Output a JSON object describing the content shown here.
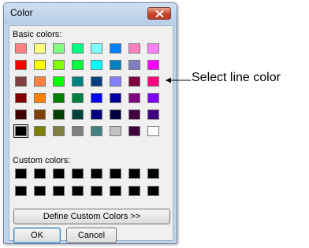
{
  "window": {
    "title": "Color",
    "close_icon": "close-icon"
  },
  "labels": {
    "basic_colors": "Basic colors:",
    "custom_colors": "Custom colors:"
  },
  "basic_colors": [
    [
      "#ff8080",
      "#ffff80",
      "#80ff80",
      "#00ff80",
      "#80ffff",
      "#0080ff",
      "#ff80c0",
      "#ff80ff"
    ],
    [
      "#ff0000",
      "#ffff00",
      "#80ff00",
      "#00ff40",
      "#00ffff",
      "#0080c0",
      "#8080c0",
      "#ff00ff"
    ],
    [
      "#804040",
      "#ff8040",
      "#00ff00",
      "#008080",
      "#004080",
      "#8080ff",
      "#800040",
      "#ff0080"
    ],
    [
      "#800000",
      "#ff8000",
      "#008000",
      "#008040",
      "#0000ff",
      "#0000a0",
      "#800080",
      "#8000ff"
    ],
    [
      "#400000",
      "#804000",
      "#004000",
      "#004040",
      "#000080",
      "#000040",
      "#400040",
      "#400080"
    ],
    [
      "#000000",
      "#808000",
      "#808040",
      "#808080",
      "#408080",
      "#c0c0c0",
      "#400040",
      "#ffffff"
    ]
  ],
  "selected_basic_color": "#000000",
  "custom_colors": [
    [
      "#000000",
      "#000000",
      "#000000",
      "#000000",
      "#000000",
      "#000000",
      "#000000",
      "#000000"
    ],
    [
      "#000000",
      "#000000",
      "#000000",
      "#000000",
      "#000000",
      "#000000",
      "#000000",
      "#000000"
    ]
  ],
  "buttons": {
    "define_custom": "Define Custom Colors >>",
    "ok": "OK",
    "cancel": "Cancel"
  },
  "callout": {
    "text": "Select line color"
  }
}
